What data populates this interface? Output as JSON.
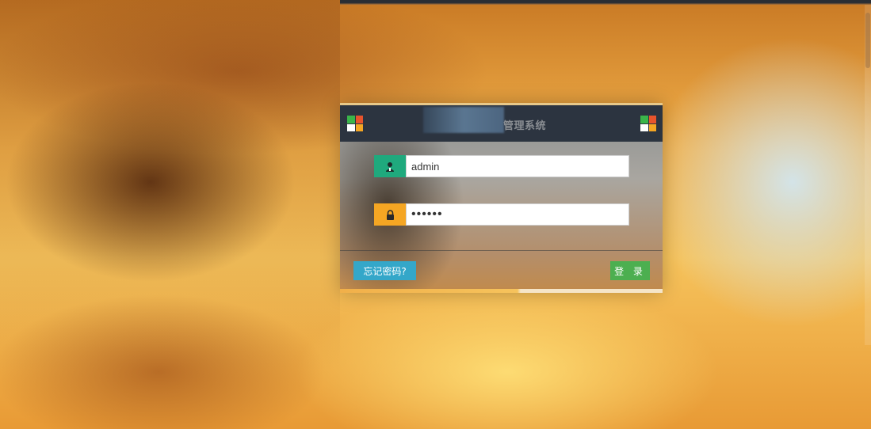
{
  "login": {
    "title": "管理系统",
    "username": {
      "value": "admin",
      "icon": "user-icon",
      "icon_color": "#1fa97d"
    },
    "password": {
      "value": "••••••",
      "icon": "lock-icon",
      "icon_color": "#f5a623"
    },
    "forgot_label": "忘记密码?",
    "submit_label": "登 录"
  },
  "colors": {
    "header_bg": "#2c3440",
    "forgot_button": "#34a7c9",
    "login_button": "#4caf50"
  }
}
